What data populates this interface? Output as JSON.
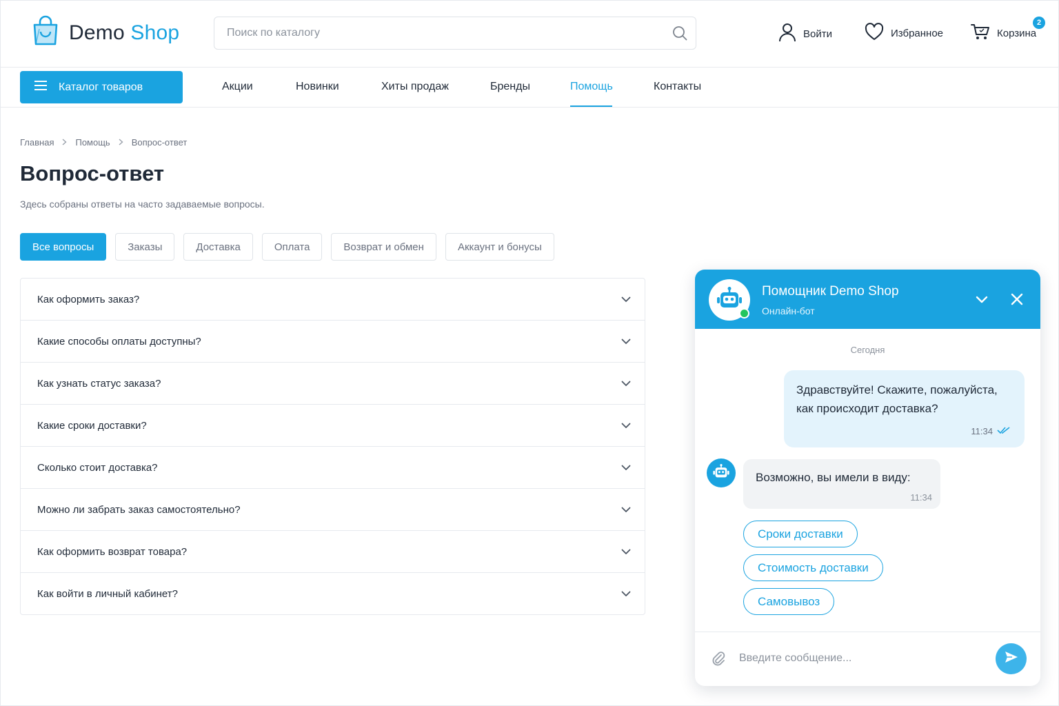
{
  "header": {
    "logo_text_1": "Demo",
    "logo_text_2": "Shop",
    "search_placeholder": "Поиск по каталогу",
    "login_label": "Войти",
    "favorites_label": "Избранное",
    "cart_label": "Корзина",
    "cart_count": "2"
  },
  "nav": {
    "catalog_label": "Каталог товаров",
    "links": [
      "Акции",
      "Новинки",
      "Хиты продаж",
      "Бренды",
      "Помощь",
      "Контакты"
    ],
    "active": "Помощь"
  },
  "breadcrumb": [
    "Главная",
    "Помощь",
    "Вопрос-ответ"
  ],
  "page": {
    "title": "Вопрос-ответ",
    "subtitle": "Здесь собраны ответы на часто задаваемые вопросы."
  },
  "filters": [
    "Все вопросы",
    "Заказы",
    "Доставка",
    "Оплата",
    "Возврат и обмен",
    "Аккаунт и бонусы"
  ],
  "active_filter": "Все вопросы",
  "faq": [
    "Как оформить заказ?",
    "Какие способы оплаты доступны?",
    "Как узнать статус заказа?",
    "Какие сроки доставки?",
    "Сколько стоит доставка?",
    "Можно ли забрать заказ самостоятельно?",
    "Как оформить возврат товара?",
    "Как войти в личный кабинет?"
  ],
  "chat": {
    "title": "Помощник Demo Shop",
    "status": "Онлайн-бот",
    "day": "Сегодня",
    "user_message": "Здравствуйте! Скажите, пожалуйста, как происходит доставка?",
    "user_time": "11:34",
    "bot_message": "Возможно, вы имели в виду:",
    "bot_time": "11:34",
    "quick_replies": [
      "Сроки доставки",
      "Стоимость доставки",
      "Самовывоз"
    ],
    "input_placeholder": "Введите сообщение..."
  },
  "colors": {
    "accent": "#1aa3e0",
    "online": "#22c55e",
    "user_bubble": "#e3f3fc",
    "bot_bubble": "#f1f3f5"
  },
  "icons": [
    "shopping-bag-icon",
    "search-icon",
    "user-icon",
    "heart-icon",
    "cart-icon",
    "menu-icon",
    "chevron-right-icon",
    "chevron-down-icon",
    "robot-icon",
    "close-icon",
    "double-check-icon",
    "paperclip-icon",
    "send-icon"
  ]
}
